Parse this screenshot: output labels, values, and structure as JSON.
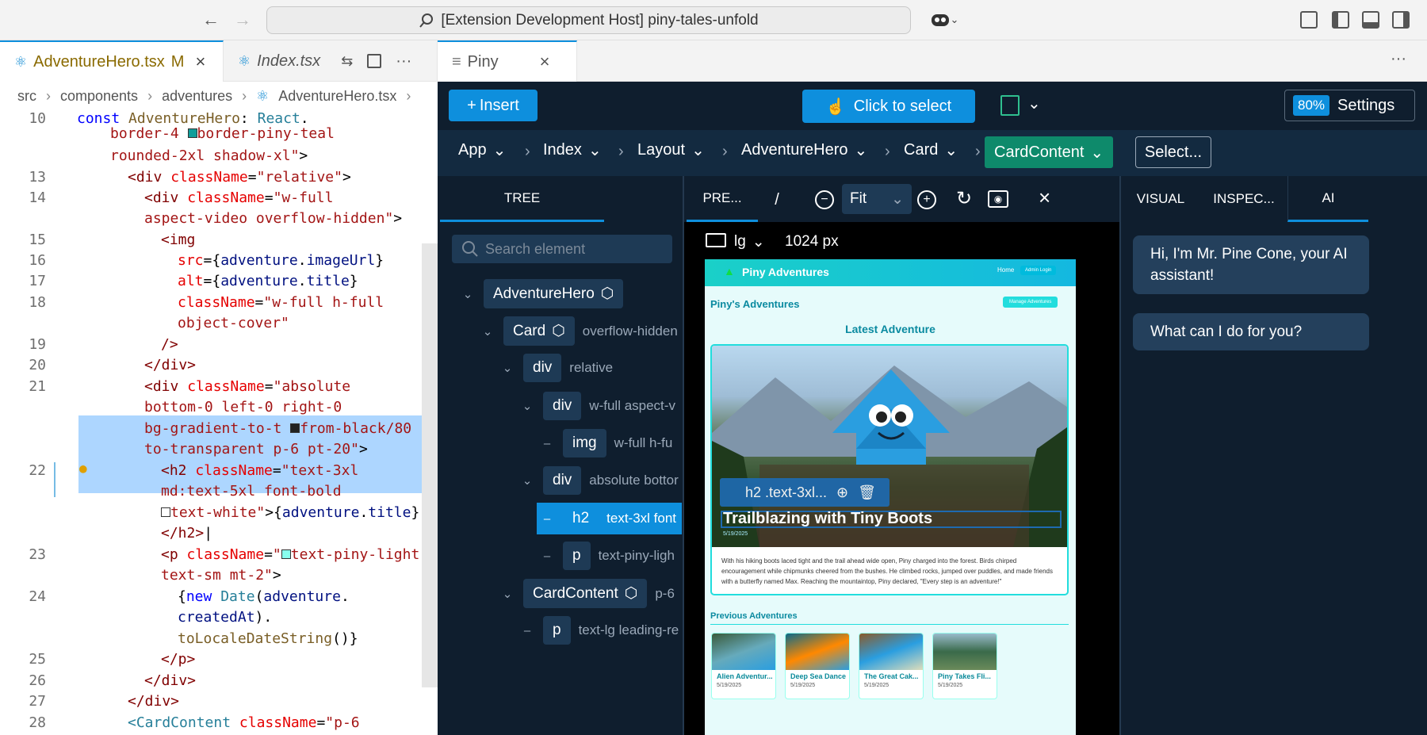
{
  "titlebar": {
    "command": "[Extension Development Host] piny-tales-unfold"
  },
  "editor_tabs": [
    {
      "label": "AdventureHero.tsx",
      "status": "M"
    },
    {
      "label": "Index.tsx"
    },
    {
      "label": "Piny"
    }
  ],
  "breadcrumb": [
    "src",
    "components",
    "adventures",
    "AdventureHero.tsx"
  ],
  "code": {
    "line_numbers": [
      "10",
      "13",
      "14",
      "15",
      "16",
      "17",
      "18",
      "19",
      "20",
      "21",
      "22",
      "23",
      "24",
      "25",
      "26",
      "27",
      "28"
    ]
  },
  "piny": {
    "insert_label": "Insert",
    "click_select_label": "Click to select",
    "zoom": "80%",
    "settings_label": "Settings",
    "breadcrumb": [
      "App",
      "Index",
      "Layout",
      "AdventureHero",
      "Card",
      "CardContent"
    ],
    "select_label": "Select...",
    "left_tab": "TREE",
    "search_placeholder": "Search element",
    "tree": [
      {
        "name": "AdventureHero",
        "cls": ""
      },
      {
        "name": "Card",
        "cls": "overflow-hidden"
      },
      {
        "name": "div",
        "cls": "relative"
      },
      {
        "name": "div",
        "cls": "w-full aspect-v"
      },
      {
        "name": "img",
        "cls": "w-full h-fu"
      },
      {
        "name": "div",
        "cls": "absolute bottor"
      },
      {
        "name": "h2",
        "cls": "text-3xl font"
      },
      {
        "name": "p",
        "cls": "text-piny-ligh"
      },
      {
        "name": "CardContent",
        "cls": "p-6"
      },
      {
        "name": "p",
        "cls": "text-lg leading-re"
      }
    ],
    "preview": {
      "tab": "PRE...",
      "slash": "/",
      "fit": "Fit",
      "device": "lg",
      "width": "1024 px",
      "site_title": "Piny Adventures",
      "nav_home": "Home",
      "nav_admin": "Admin Login",
      "page_title": "Piny's Adventures",
      "manage": "Manage Adventures",
      "latest": "Latest Adventure",
      "hero_title": "Trailblazing with Tiny Boots",
      "hero_date": "5/19/2025",
      "overlay_label": "h2 .text-3xl...",
      "story": "With his hiking boots laced tight and the trail ahead wide open, Piny charged into the forest. Birds chirped encouragement while chipmunks cheered from the bushes. He climbed rocks, jumped over puddles, and made friends with a butterfly named Max. Reaching the mountaintop, Piny declared, \"Every step is an adventure!\"",
      "previous": "Previous Adventures",
      "thumbs": [
        {
          "title": "Alien Adventur...",
          "date": "5/19/2025"
        },
        {
          "title": "Deep Sea Dance",
          "date": "5/19/2025"
        },
        {
          "title": "The Great Cak...",
          "date": "5/19/2025"
        },
        {
          "title": "Piny Takes Fli...",
          "date": "5/19/2025"
        }
      ]
    },
    "right_tabs": [
      "VISUAL",
      "INSPEC...",
      "AI"
    ],
    "ai_messages": [
      "Hi, I'm Mr. Pine Cone, your AI assistant!",
      "What can I do for you?"
    ]
  },
  "colors": {
    "accent": "#0e8fdd",
    "bg": "#0f1e2e",
    "selected_crumb": "#0e8a6b"
  }
}
